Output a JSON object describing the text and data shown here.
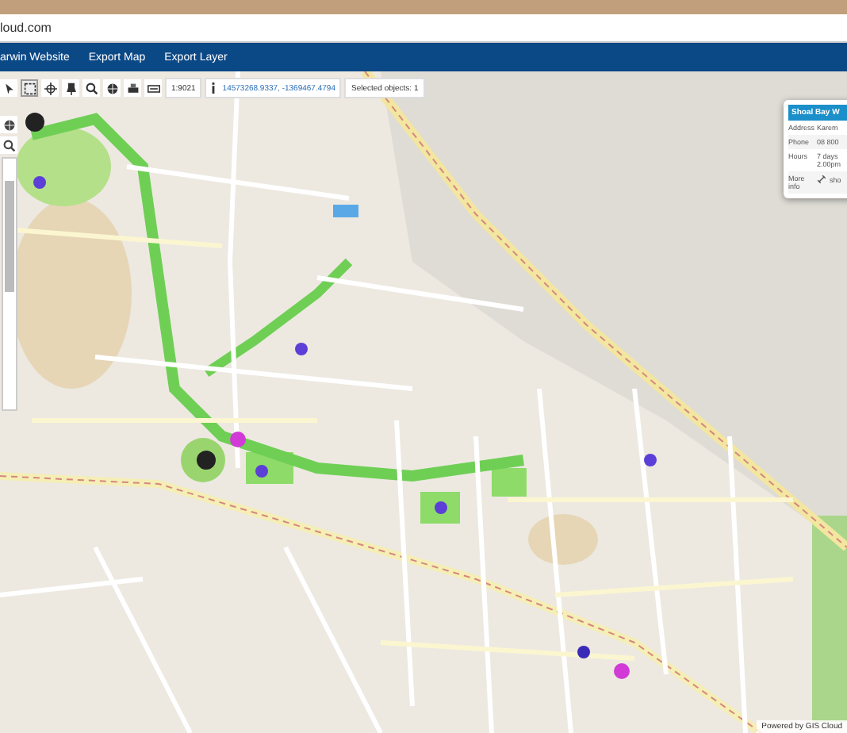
{
  "browser": {
    "url": "loud.com"
  },
  "nav": {
    "items": [
      "arwin Website",
      "Export Map",
      "Export Layer"
    ]
  },
  "toolbar": {
    "tools": [
      {
        "kind": "pointer",
        "selected": false
      },
      {
        "kind": "select",
        "selected": true
      },
      {
        "kind": "pan",
        "selected": false
      },
      {
        "kind": "pin",
        "selected": false
      },
      {
        "kind": "zoom",
        "selected": false
      },
      {
        "kind": "globe",
        "selected": false
      },
      {
        "kind": "print",
        "selected": false
      },
      {
        "kind": "keyboard",
        "selected": false
      }
    ],
    "scale": "1:9021",
    "coordinates": "14573268.9337, -1369467.4794",
    "selection": "Selected objects: 1"
  },
  "popup": {
    "title": "Shoal Bay W",
    "rows": [
      {
        "label": "Address",
        "lines": [
          "Karem"
        ],
        "kind": "text"
      },
      {
        "label": "Phone",
        "lines": [
          "08 800"
        ],
        "kind": "text"
      },
      {
        "label": "Hours",
        "lines": [
          "7 days",
          "2.00pm"
        ],
        "kind": "text"
      },
      {
        "label": "More info",
        "lines": [
          "sho"
        ],
        "kind": "link"
      }
    ]
  },
  "attribution": "Powered by GIS Cloud"
}
